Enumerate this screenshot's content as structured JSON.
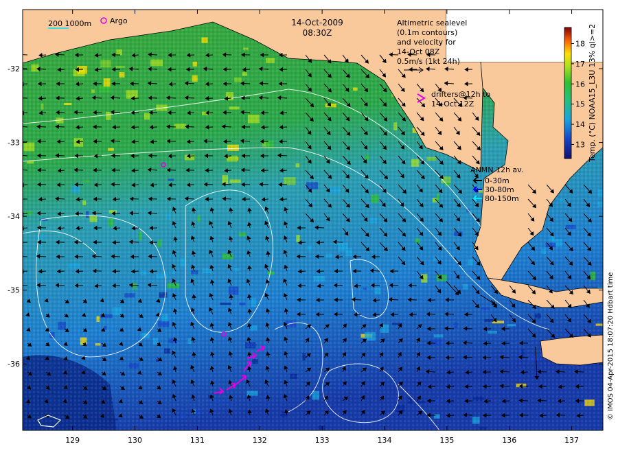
{
  "title": {
    "date": "14-Oct-2009",
    "time": "08:30Z"
  },
  "scale_bar": {
    "label": "200  1000m",
    "argo_label": "Argo"
  },
  "altimetry_note": [
    "Altimetric sealevel",
    "(0.1m contours)",
    "and velocity for",
    "14-Oct 08Z",
    "0.5m/s (1kt 24h)"
  ],
  "drifters_note": [
    "drifters@12h to",
    "14-Oct 12Z"
  ],
  "anmn": {
    "title": "ANMN 12h av.",
    "items": [
      {
        "label": "0-30m",
        "color": "#000000"
      },
      {
        "label": "30-80m",
        "color": "#0000ff"
      },
      {
        "label": "80-150m",
        "color": "#00e5ff"
      }
    ]
  },
  "colorbar": {
    "label": "Temp. (°C) NOAA15_L3U 13% ql>=2",
    "ticks": [
      "13",
      "14",
      "15",
      "16",
      "17",
      "18"
    ],
    "min": 12.3,
    "max": 18.8
  },
  "credit": "© IMOS 04-Apr-2015 18:07:20 Hdbart time",
  "axes": {
    "x_ticks": [
      "129",
      "130",
      "131",
      "132",
      "133",
      "134",
      "135",
      "136",
      "137"
    ],
    "y_ticks": [
      "-32",
      "-33",
      "-34",
      "-35",
      "-36"
    ],
    "lon_range": [
      128.2,
      137.5
    ],
    "lat_range": [
      -36.9,
      -31.2
    ]
  },
  "colors": {
    "land": "#f9c89b",
    "shallow": "#2ca63a",
    "warm": "#ffe000",
    "cool": "#1e9ad6",
    "cold": "#0a2a9a",
    "argo": "#e000e0",
    "drifter": "#e000e0"
  }
}
